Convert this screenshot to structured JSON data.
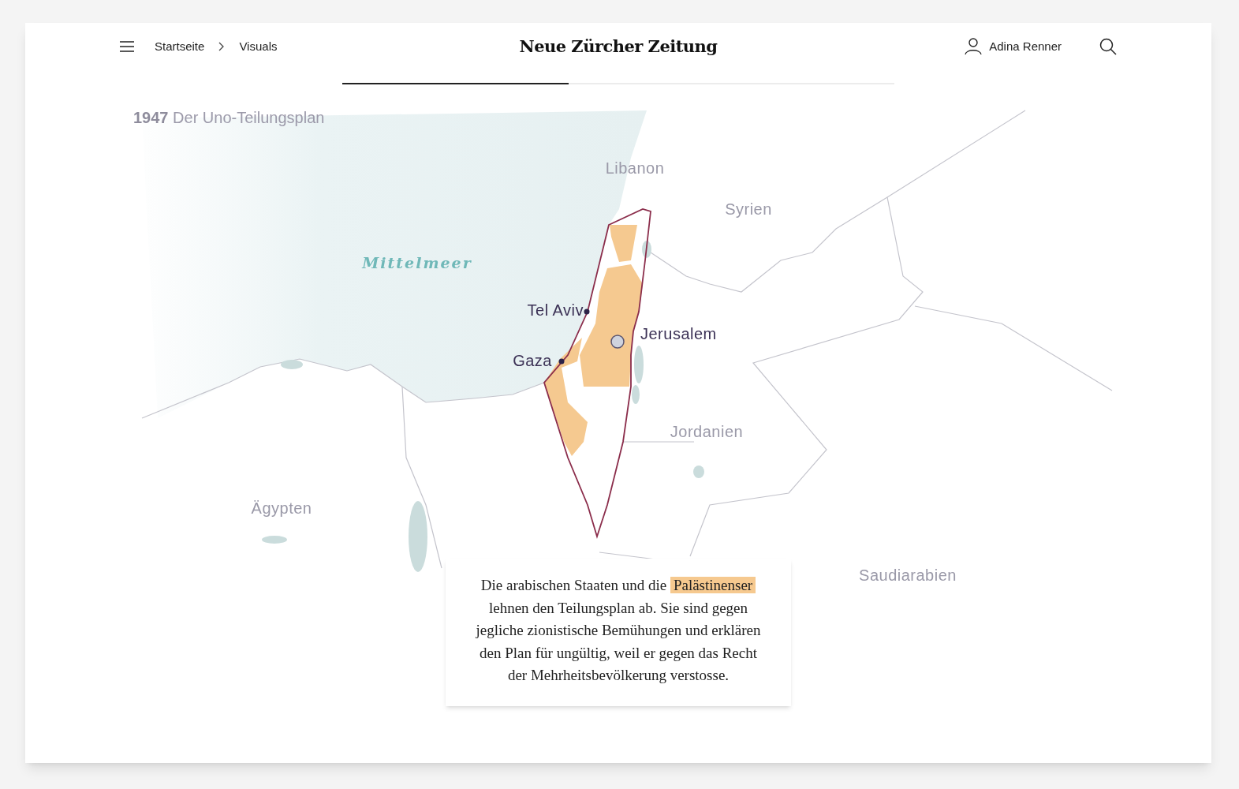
{
  "header": {
    "breadcrumbs": [
      {
        "label": "Startseite"
      },
      {
        "label": "Visuals"
      }
    ],
    "logo": "Neue Zürcher Zeitung",
    "user": "Adina Renner"
  },
  "progress": {
    "level": 0.41
  },
  "map": {
    "year": "1947",
    "title": "Der Uno-Teilungsplan",
    "labels": [
      {
        "kind": "country",
        "text": "Libanon"
      },
      {
        "kind": "country",
        "text": "Syrien"
      },
      {
        "kind": "sea",
        "text": "Mittelmeer"
      },
      {
        "kind": "city",
        "text": "Tel Aviv"
      },
      {
        "kind": "capital",
        "text": "Jerusalem"
      },
      {
        "kind": "city",
        "text": "Gaza"
      },
      {
        "kind": "country",
        "text": "Jordanien"
      },
      {
        "kind": "country",
        "text": "Ägypten"
      },
      {
        "kind": "country",
        "text": "Saudiarabien"
      }
    ]
  },
  "caption": {
    "before": "Die arabischen Staaten und die",
    "highlight": "Palästinenser",
    "after": "lehnen den Teilungsplan ab. Sie sind gegen jegliche zionistische Bemühungen und erklären den Plan für ungültig, weil er gegen das Recht der Mehrheitsbevölkerung verstosse."
  }
}
